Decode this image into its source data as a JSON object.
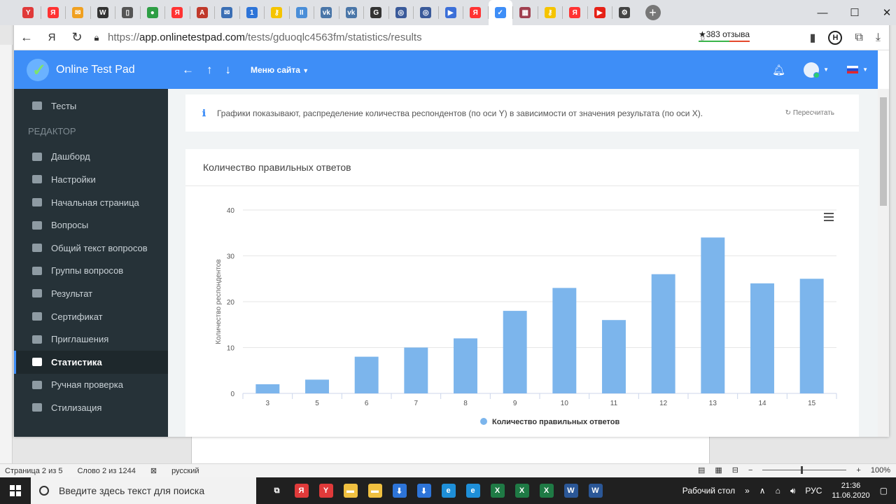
{
  "browser": {
    "url_prefix": "https://",
    "url_host": "app.onlinetestpad.com",
    "url_path": "/tests/gduoqlc4563fm/statistics/results",
    "reviews": "★383 отзыва",
    "tabs": [
      {
        "icon": "yandex-browser-icon",
        "label": "Y",
        "color": "#e03a3a"
      },
      {
        "icon": "yandex-icon",
        "label": "Я",
        "color": "#ff3333"
      },
      {
        "icon": "mail-icon",
        "label": "✉",
        "color": "#f0a020"
      },
      {
        "icon": "wikipedia-icon",
        "label": "W",
        "color": "#333333"
      },
      {
        "icon": "document-icon",
        "label": "▯",
        "color": "#555555"
      },
      {
        "icon": "circle-icon",
        "label": "●",
        "color": "#2e9e45"
      },
      {
        "icon": "yandex-icon",
        "label": "Я",
        "color": "#ff3333"
      },
      {
        "icon": "acrobat-icon",
        "label": "A",
        "color": "#c0392b"
      },
      {
        "icon": "email-icon",
        "label": "✉",
        "color": "#3b6fb5"
      },
      {
        "icon": "one-icon",
        "label": "1",
        "color": "#2d74d8"
      },
      {
        "icon": "key-icon",
        "label": "⚷",
        "color": "#f5c400"
      },
      {
        "icon": "pause-icon",
        "label": "II",
        "color": "#4a8ed8"
      },
      {
        "icon": "vk-icon",
        "label": "vk",
        "color": "#4a76a8"
      },
      {
        "icon": "vk-icon",
        "label": "vk",
        "color": "#4a76a8"
      },
      {
        "icon": "g-icon",
        "label": "G",
        "color": "#333333"
      },
      {
        "icon": "globe-icon",
        "label": "◎",
        "color": "#3a5a9a"
      },
      {
        "icon": "globe-icon",
        "label": "◎",
        "color": "#3a5a9a"
      },
      {
        "icon": "play-icon",
        "label": "▶",
        "color": "#3b6fd8"
      },
      {
        "icon": "yandex-icon",
        "label": "Я",
        "color": "#ff3333"
      },
      {
        "icon": "onlinetestpad-icon",
        "label": "✓",
        "color": "#3e8ef7",
        "active": true
      },
      {
        "icon": "calendar-icon",
        "label": "▦",
        "color": "#a04050"
      },
      {
        "icon": "key-icon",
        "label": "⚷",
        "color": "#f5c400"
      },
      {
        "icon": "yandex-icon",
        "label": "Я",
        "color": "#ff3333"
      },
      {
        "icon": "youtube-icon",
        "label": "▶",
        "color": "#e62117"
      },
      {
        "icon": "settings-icon",
        "label": "⚙",
        "color": "#444444"
      }
    ]
  },
  "header": {
    "app_name": "Online Test Pad",
    "menu_site": "Меню сайта"
  },
  "sidebar": {
    "top_item": "Тесты",
    "section": "Редактор",
    "items": [
      {
        "label": "Дашборд",
        "icon": "dashboard-icon"
      },
      {
        "label": "Настройки",
        "icon": "gear-icon"
      },
      {
        "label": "Начальная страница",
        "icon": "page-icon"
      },
      {
        "label": "Вопросы",
        "icon": "comment-icon"
      },
      {
        "label": "Общий текст вопросов",
        "icon": "text-icon"
      },
      {
        "label": "Группы вопросов",
        "icon": "groups-icon"
      },
      {
        "label": "Результат",
        "icon": "result-icon"
      },
      {
        "label": "Сертификат",
        "icon": "certificate-icon"
      },
      {
        "label": "Приглашения",
        "icon": "invite-icon"
      },
      {
        "label": "Статистика",
        "icon": "stats-icon",
        "active": true
      },
      {
        "label": "Ручная проверка",
        "icon": "paw-icon"
      },
      {
        "label": "Стилизация",
        "icon": "style-icon"
      }
    ]
  },
  "info": {
    "text": "Графики показывают, распределение количества респондентов (по оси Y) в зависимости от значения результата (по оси X).",
    "recalc": "Пересчитать"
  },
  "chart_data": {
    "type": "bar",
    "title": "Количество правильных ответов",
    "ylabel": "Количество респондентов",
    "xlabel": "",
    "categories": [
      "3",
      "5",
      "6",
      "7",
      "8",
      "9",
      "10",
      "11",
      "12",
      "13",
      "14",
      "15"
    ],
    "series": [
      {
        "name": "Количество правильных ответов",
        "values": [
          2,
          3,
          8,
          10,
          12,
          18,
          23,
          16,
          26,
          34,
          24,
          25
        ]
      }
    ],
    "ylim": [
      0,
      40
    ],
    "yticks": [
      "0",
      "10",
      "20",
      "30",
      "40"
    ],
    "grid": true,
    "legend": "bottom",
    "color": "#7cb5ec"
  },
  "word": {
    "page": "Страница 2 из 5",
    "words": "Слово 2 из 1244",
    "lang": "русский",
    "zoom": "100%",
    "zoom_minus": "−",
    "zoom_plus": "+"
  },
  "taskbar": {
    "search_placeholder": "Введите здесь текст для поиска",
    "desktop": "Рабочий стол",
    "lang": "РУС",
    "time": "21:36",
    "date": "11.06.2020",
    "apps": [
      {
        "icon": "task-view-icon",
        "label": "⧉",
        "color": "#202020"
      },
      {
        "icon": "yandex-icon",
        "label": "Я",
        "color": "#e03a3a"
      },
      {
        "icon": "yandex-browser-icon",
        "label": "Y",
        "color": "#e03a3a"
      },
      {
        "icon": "folder-icon",
        "label": "▬",
        "color": "#f0c040"
      },
      {
        "icon": "folder-icon",
        "label": "▬",
        "color": "#f0c040"
      },
      {
        "icon": "download-icon",
        "label": "⬇",
        "color": "#2d74d8"
      },
      {
        "icon": "download-icon",
        "label": "⬇",
        "color": "#2d74d8"
      },
      {
        "icon": "edge-icon",
        "label": "e",
        "color": "#1e8fd8"
      },
      {
        "icon": "edge-icon",
        "label": "e",
        "color": "#1e8fd8"
      },
      {
        "icon": "excel-icon",
        "label": "X",
        "color": "#1f7a45"
      },
      {
        "icon": "excel-icon",
        "label": "X",
        "color": "#1f7a45"
      },
      {
        "icon": "excel-icon",
        "label": "X",
        "color": "#1f7a45"
      },
      {
        "icon": "word-icon",
        "label": "W",
        "color": "#2b5797"
      },
      {
        "icon": "word-icon",
        "label": "W",
        "color": "#2b5797"
      }
    ]
  }
}
